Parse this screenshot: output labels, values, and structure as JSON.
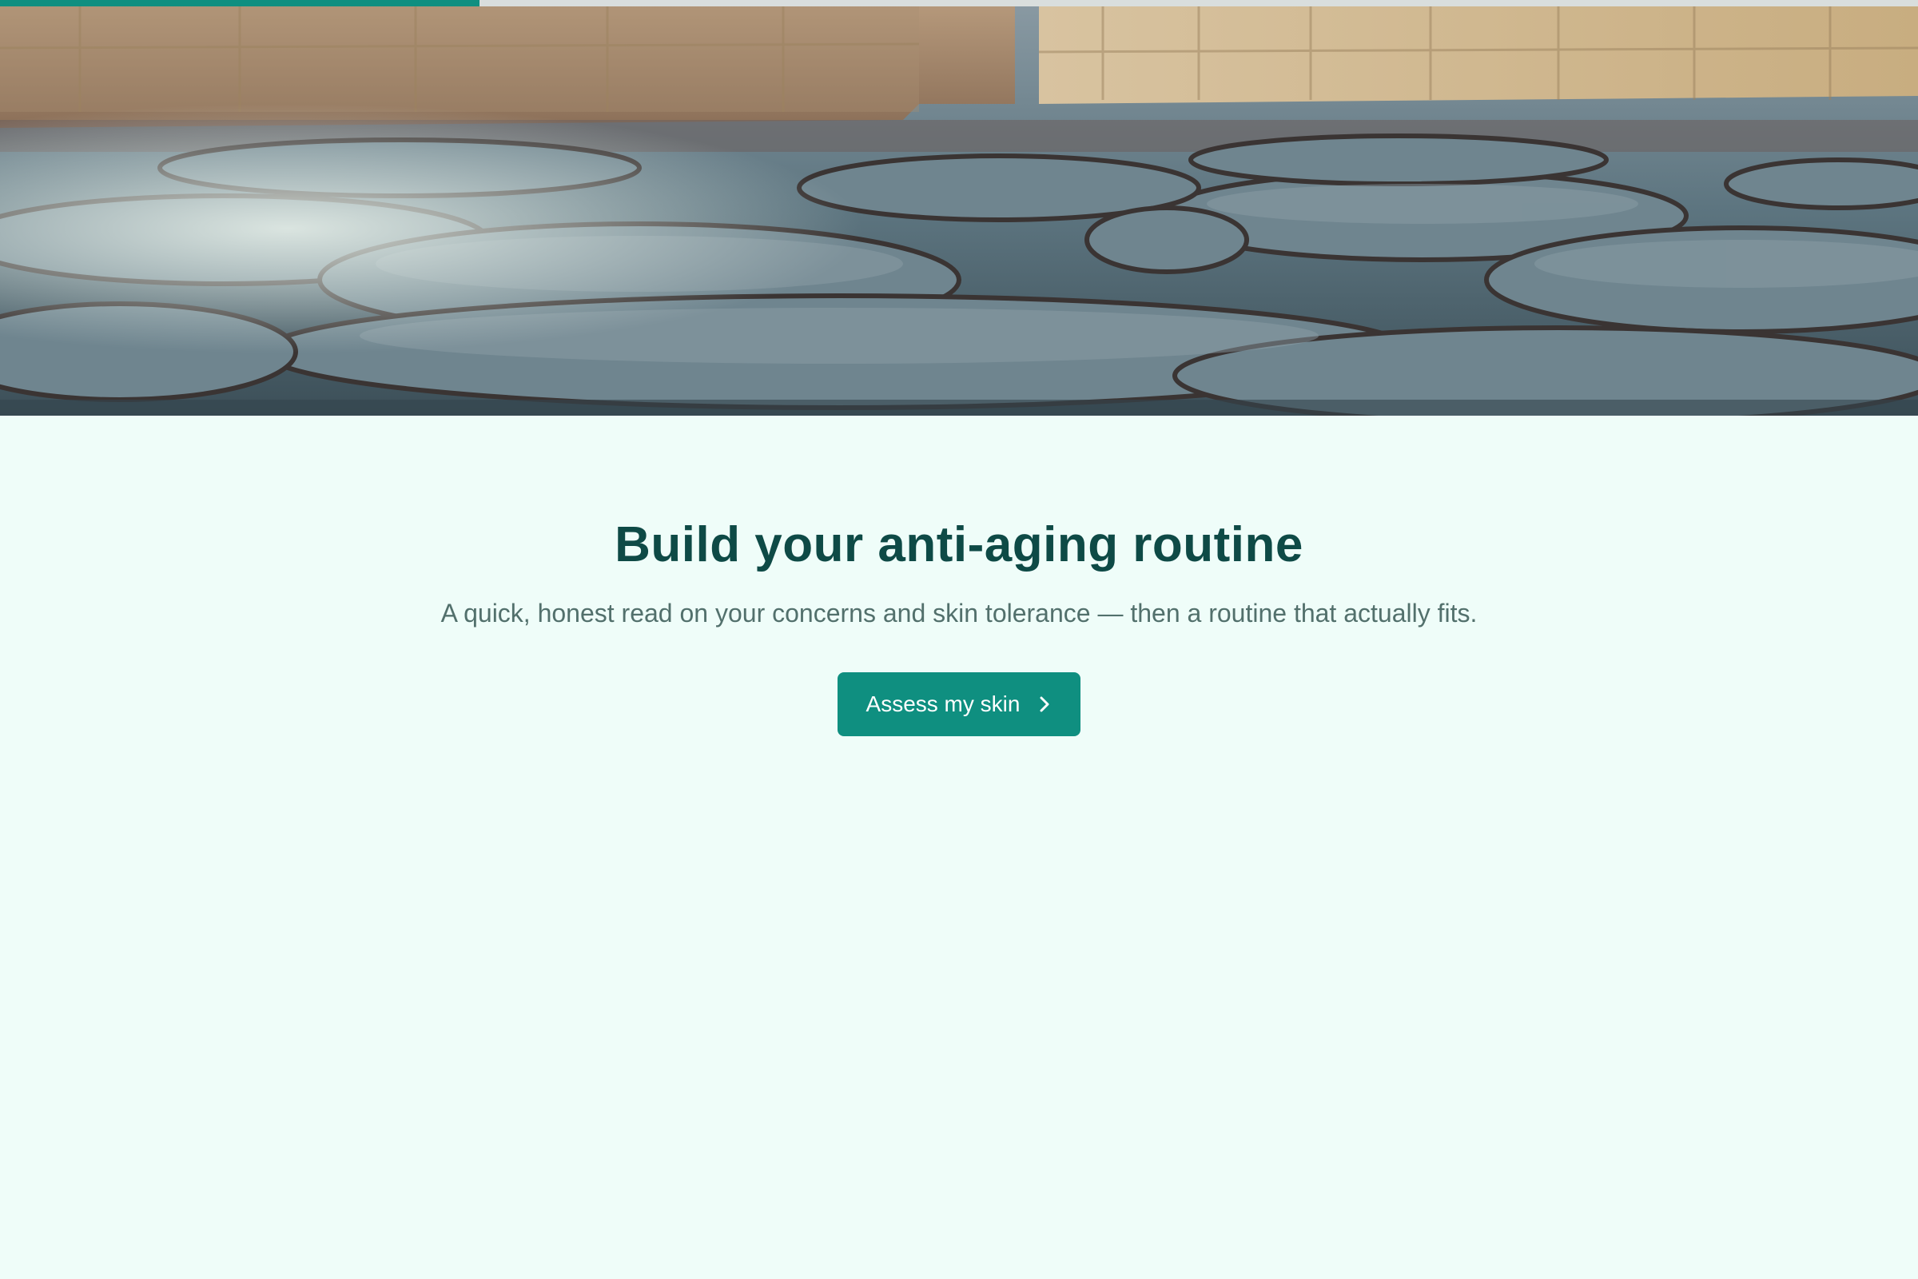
{
  "progress": {
    "value": 0.25,
    "fill_color": "#0f8f80"
  },
  "hero": {
    "image_alt": "cobblestone street between stone walls"
  },
  "main": {
    "title": "Build your anti-aging routine",
    "subtitle": "A quick, honest read on your concerns and skin tolerance — then a routine that actually fits.",
    "cta_label": "Assess my skin",
    "cta_icon": "chevron-right-icon"
  },
  "colors": {
    "background": "#effdf9",
    "title": "#0e4a46",
    "subtitle": "#52706c",
    "accent": "#0f8f80"
  }
}
